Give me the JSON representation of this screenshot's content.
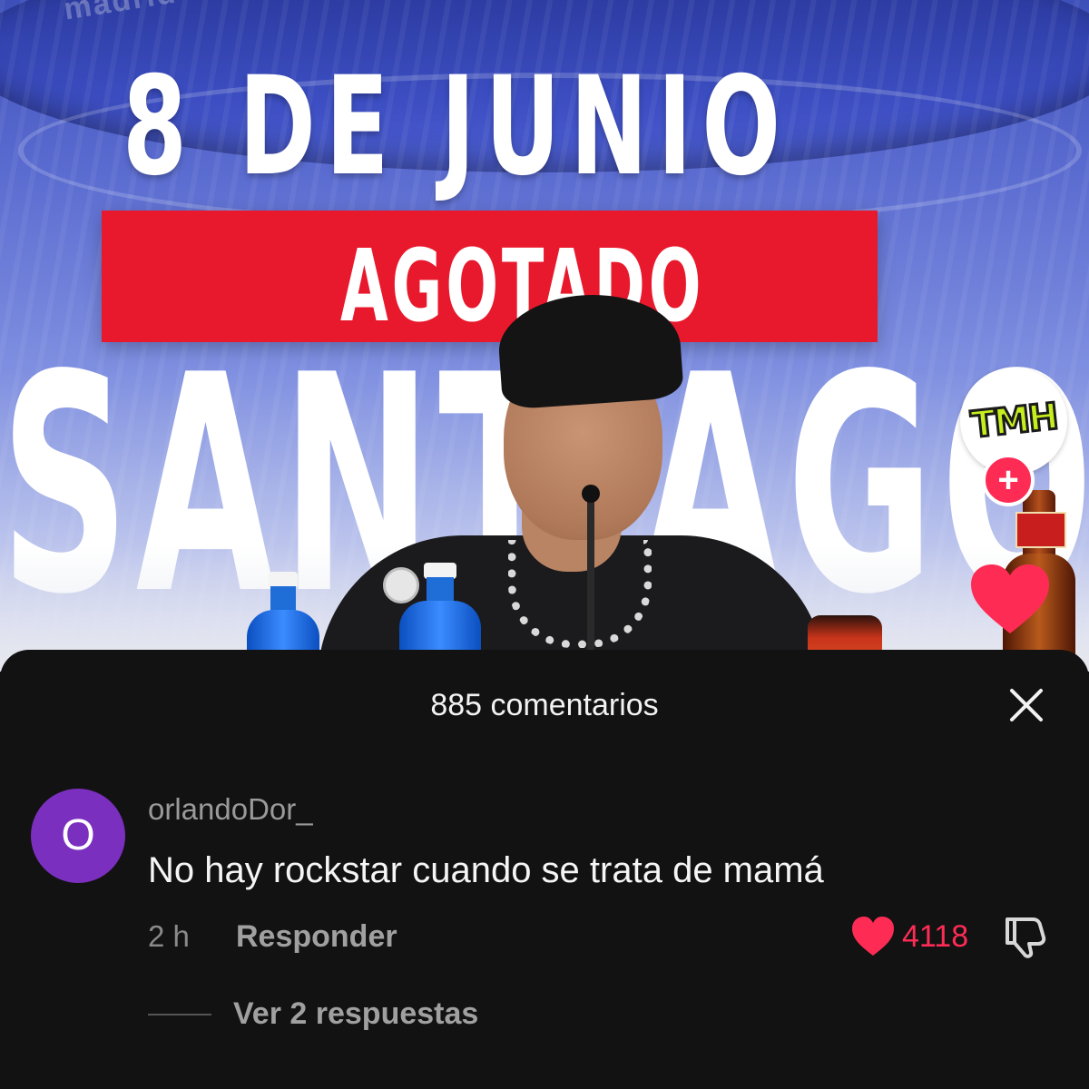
{
  "video": {
    "venue_watermark": "madrid",
    "date_text": "8 DE JUNIO",
    "sold_out_text": "AGOTADO",
    "venue_text": "SANTIAGO BE",
    "profile_avatar_text": "TMH"
  },
  "comments_sheet": {
    "title": "885 comentarios",
    "comments": [
      {
        "avatar_initial": "O",
        "avatar_color": "#7b2fbf",
        "username": "orlandoDor_",
        "text": "No hay rockstar cuando se trata de mamá",
        "timestamp": "2 h",
        "reply_label": "Responder",
        "like_count": "4118",
        "view_replies_label": "Ver 2 respuestas"
      }
    ]
  },
  "colors": {
    "accent": "#fe2c55",
    "sheet_background": "#121212",
    "banner_red": "#e8192c"
  },
  "icons": {
    "close": "close-icon",
    "like": "heart-icon",
    "dislike": "thumbs-down-icon",
    "follow": "plus-icon"
  }
}
